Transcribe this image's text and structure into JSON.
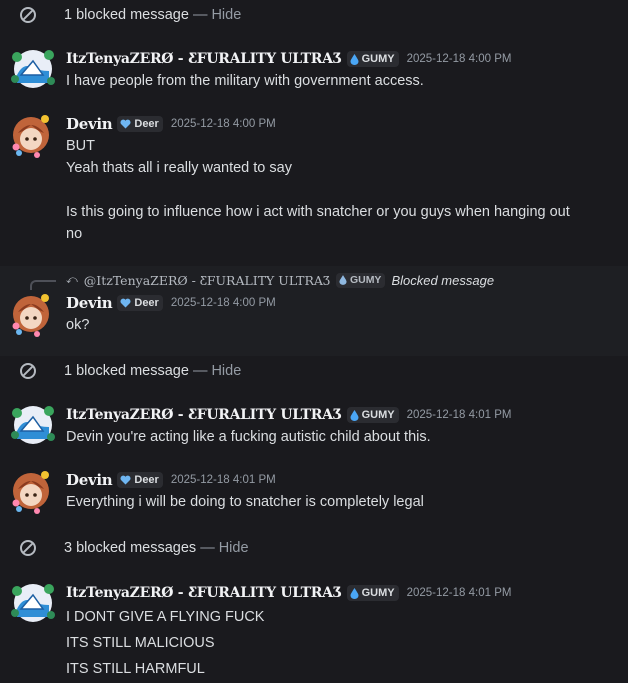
{
  "blocked": [
    {
      "count_text": "1 blocked message",
      "sep": "—",
      "hide": "Hide"
    },
    {
      "count_text": "1 blocked message",
      "sep": "—",
      "hide": "Hide"
    },
    {
      "count_text": "3 blocked messages",
      "sep": "—",
      "hide": "Hide"
    }
  ],
  "users": {
    "tenya": {
      "name": "ItzTenyaZERØ - ƸFURALITY ULTRAƷ",
      "tag": "GUMY",
      "tag_icon": "water-drop-icon"
    },
    "devin": {
      "name": "Devin",
      "tag": "Deer",
      "tag_icon": "heart-shield-icon"
    }
  },
  "messages": [
    {
      "author": "ItzTenyaZERØ - ƸFURALITY ULTRAƷ",
      "tag": "GUMY",
      "time": "2025-12-18 4:00 PM",
      "lines": [
        "I have people from the military with government access."
      ]
    },
    {
      "author": "Devin",
      "tag": "Deer",
      "time": "2025-12-18 4:00 PM",
      "lines": [
        "BUT",
        "Yeah thats all i really wanted to say",
        "",
        "Is this going to influence how i act with snatcher or you guys when hanging out",
        "no"
      ]
    },
    {
      "author": "Devin",
      "tag": "Deer",
      "time": "2025-12-18 4:00 PM",
      "reply": {
        "name": "@ItzTenyaZERØ - ƸFURALITY ULTRAƷ",
        "tag": "GUMY",
        "text": "Blocked message"
      },
      "lines": [
        "ok?"
      ]
    },
    {
      "author": "ItzTenyaZERØ - ƸFURALITY ULTRAƷ",
      "tag": "GUMY",
      "time": "2025-12-18 4:01 PM",
      "lines": [
        "Devin you're acting like a fucking autistic child about this."
      ]
    },
    {
      "author": "Devin",
      "tag": "Deer",
      "time": "2025-12-18 4:01 PM",
      "lines": [
        "Everything i will be doing to snatcher is completely legal"
      ]
    },
    {
      "author": "ItzTenyaZERØ - ƸFURALITY ULTRAƷ",
      "tag": "GUMY",
      "time": "2025-12-18 4:01 PM",
      "lines": [
        "I DONT GIVE A FLYING FUCK",
        "ITS STILL MALICIOUS",
        "ITS STILL HARMFUL"
      ]
    }
  ],
  "colors": {
    "background": "#1a1a1e",
    "highlight": "#1e1f23",
    "tag_bg": "#2b2c31",
    "gumy_icon": "#4aa6f5",
    "deer_icon": "#6fb6f2"
  }
}
